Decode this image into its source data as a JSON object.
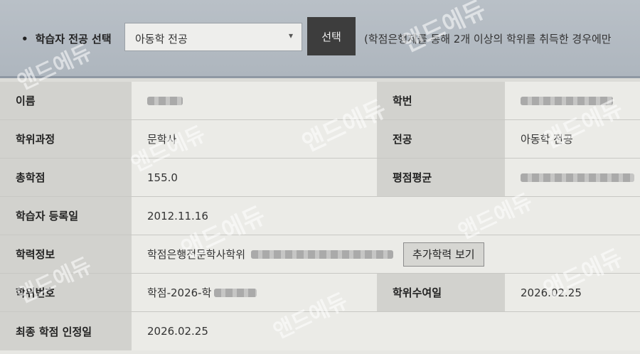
{
  "selector": {
    "label": "학습자 전공 선택",
    "selected": "아동학 전공",
    "button": "선택",
    "note": "(학점은행제를 통해 2개 이상의 학위를 취득한 경우에만"
  },
  "fields": {
    "name_label": "이름",
    "student_no_label": "학번",
    "degree_course_label": "학위과정",
    "degree_course_value": "문학사",
    "major_label": "전공",
    "major_value": "아동학 전공",
    "total_credits_label": "총학점",
    "total_credits_value": "155.0",
    "gpa_label": "평점평균",
    "reg_date_label": "학습자 등록일",
    "reg_date_value": "2012.11.16",
    "academic_info_label": "학력정보",
    "academic_info_value": "학점은행전문학사학위",
    "academic_info_button": "추가학력 보기",
    "degree_no_label": "학위번호",
    "degree_no_value": "학점-2026-학",
    "degree_date_label": "학위수여일",
    "degree_date_value": "2026.02.25",
    "final_credit_label": "최종 학점 인정일",
    "final_credit_value": "2026.02.25"
  },
  "watermark": "앤드에듀"
}
